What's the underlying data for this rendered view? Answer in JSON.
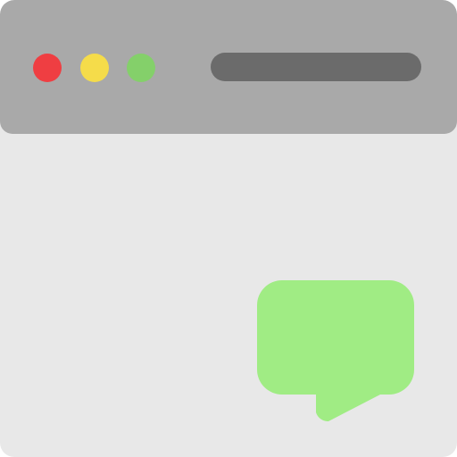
{
  "window": {
    "titlebar_color": "#a9a9a9",
    "content_color": "#e8e8e8"
  },
  "controls": [
    {
      "name": "close",
      "color": "#ef3e42"
    },
    {
      "name": "minimize",
      "color": "#f5dc4a"
    },
    {
      "name": "maximize",
      "color": "#84d06a"
    }
  ],
  "address_bar": {
    "value": "",
    "color": "#6b6b6b"
  },
  "chat_icon": {
    "icon": "speech-bubble-icon",
    "color": "#a0ec84"
  }
}
